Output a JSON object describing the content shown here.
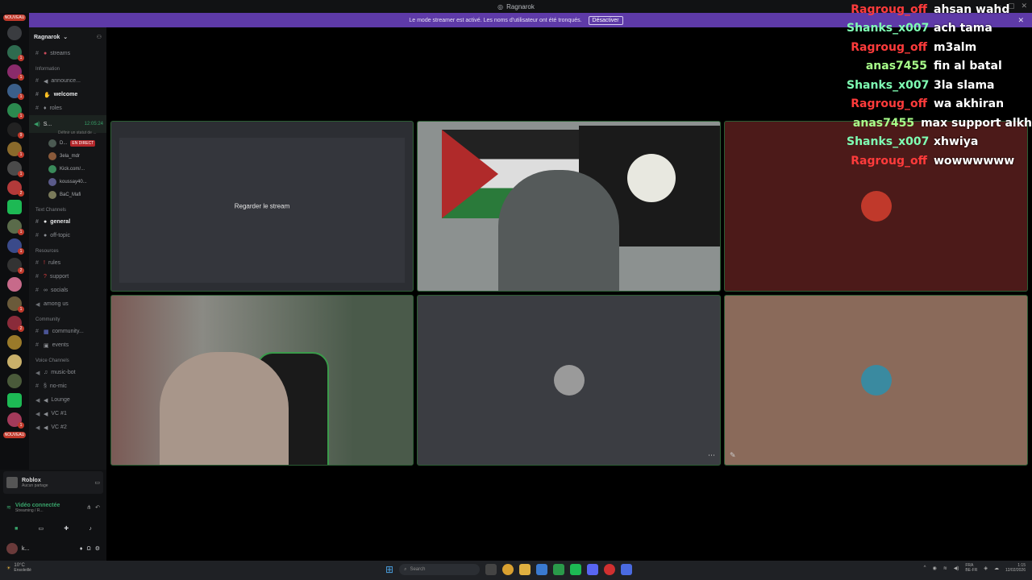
{
  "window": {
    "title": "Ragnarok"
  },
  "banner": {
    "text": "Le mode streamer est activé. Les noms d'utilisateur ont été tronqués.",
    "button": "Désactiver"
  },
  "servers": {
    "new_badge": "NOUVEAU",
    "badges": [
      "1",
      "1",
      "1",
      "1",
      "9",
      "1",
      "1",
      "2",
      "1",
      "1",
      "2",
      "1",
      "2",
      "1"
    ]
  },
  "guild": {
    "name": "Ragnarok"
  },
  "channels": {
    "streams": "streams",
    "cat_information": "Information",
    "announce": "announce...",
    "welcome": "welcome",
    "roles": "roles",
    "voice_active": "S...",
    "voice_timer": "12:05:24",
    "voice_sub": "Définir un statut de ...",
    "users": [
      {
        "name": "D...",
        "live": "EN DIRECT"
      },
      {
        "name": "3ela_mdr"
      },
      {
        "name": "Kick.com/..."
      },
      {
        "name": "koussay40..."
      },
      {
        "name": "BaC_Mafi"
      }
    ],
    "cat_text": "Text Channels",
    "general": "general",
    "offtopic": "off-topic",
    "cat_resources": "Resources",
    "rules": "rules",
    "support": "support",
    "socials": "socials",
    "among": "among us",
    "cat_community": "Community",
    "community": "community...",
    "events": "events",
    "cat_voice": "Voice Channels",
    "musicbot": "music-bot",
    "nomic": "no-mic",
    "lounge": "Lounge",
    "vc1": "VC #1",
    "vc2": "VC #2"
  },
  "panel": {
    "activity": "Roblox",
    "activity_sub": "Aucun partage",
    "voice_status": "Vidéo connectée",
    "voice_sub": "Streaming / R...",
    "user": "k..."
  },
  "tiles": {
    "watch_label": "Regarder le stream"
  },
  "chat": [
    {
      "nick": "Ragroug_off",
      "text": "ahsan wahd",
      "color": "#ff3b3b"
    },
    {
      "nick": "Shanks_x007",
      "text": "ach tama",
      "color": "#7fffb4"
    },
    {
      "nick": "Ragroug_off",
      "text": "m3alm",
      "color": "#ff3b3b"
    },
    {
      "nick": "anas7455",
      "text": "fin al batal",
      "color": "#a8ff8a"
    },
    {
      "nick": "Shanks_x007",
      "text": "3la slama",
      "color": "#7fffb4"
    },
    {
      "nick": "Ragroug_off",
      "text": "wa akhiran",
      "color": "#ff3b3b"
    },
    {
      "nick": "anas7455",
      "text": "max support alkh",
      "color": "#a8ff8a"
    },
    {
      "nick": "Shanks_x007",
      "text": "xhwiya",
      "color": "#7fffb4"
    },
    {
      "nick": "Ragroug_off",
      "text": "wowwwwww",
      "color": "#ff3b3b"
    }
  ],
  "taskbar": {
    "weather": "10°C",
    "weather_sub": "Ensoleillé",
    "search": "Search",
    "lang": "FRA",
    "lang_sub": "BE-FR",
    "time": "1:15",
    "date": "12/02/2026"
  }
}
